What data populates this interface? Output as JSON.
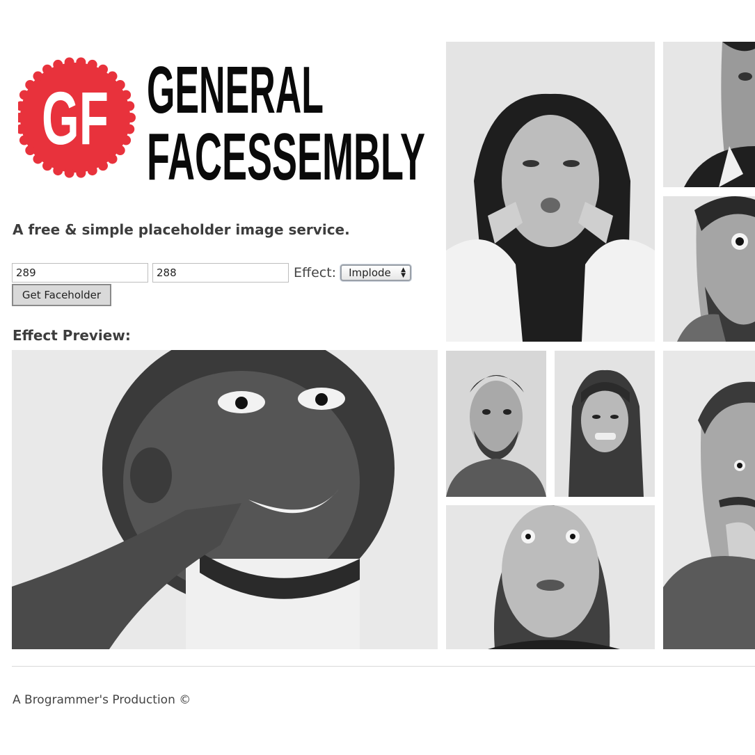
{
  "brand": {
    "badge_text": "GF",
    "name_line1": "GENERAL",
    "name_line2": "FACESSEMBLY",
    "accent_color": "#e8323c"
  },
  "tagline": "A free & simple placeholder image service.",
  "form": {
    "width_value": "289",
    "height_value": "288",
    "effect_label": "Effect:",
    "effect_selected": "Implode",
    "submit_label": "Get Faceholder"
  },
  "preview": {
    "label": "Effect Preview:"
  },
  "gallery": {
    "count": 8
  },
  "footer": {
    "credit": "A Brogrammer's Production ©"
  }
}
